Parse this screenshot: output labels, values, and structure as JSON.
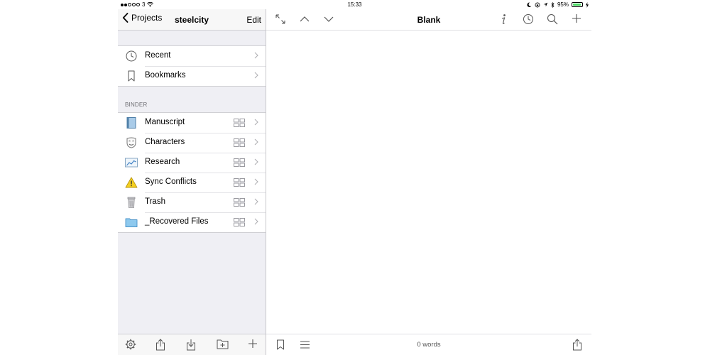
{
  "status_bar": {
    "carrier": "3",
    "time": "15:33",
    "battery_percent": "95%",
    "battery_level": 0.95
  },
  "sidebar": {
    "back_label": "Projects",
    "title": "steelcity",
    "edit_label": "Edit",
    "top_items": [
      {
        "label": "Recent",
        "icon": "clock-icon"
      },
      {
        "label": "Bookmarks",
        "icon": "bookmark-icon"
      }
    ],
    "binder_header": "BINDER",
    "binder_items": [
      {
        "label": "Manuscript",
        "icon": "manuscript-icon"
      },
      {
        "label": "Characters",
        "icon": "characters-icon"
      },
      {
        "label": "Research",
        "icon": "research-icon"
      },
      {
        "label": "Sync Conflicts",
        "icon": "warning-icon"
      },
      {
        "label": "Trash",
        "icon": "trash-icon"
      },
      {
        "label": "_Recovered Files",
        "icon": "folder-icon"
      }
    ],
    "toolbar": [
      "settings-icon",
      "share-icon",
      "import-icon",
      "new-folder-icon",
      "add-icon"
    ]
  },
  "editor": {
    "title": "Blank",
    "word_count": "0 words"
  },
  "colors": {
    "sidebar_bg": "#efeff4",
    "battery_green": "#4cd964",
    "warning_yellow": "#f5d020",
    "folder_blue": "#8ec9ee",
    "icon_gray": "#8e8e93"
  }
}
